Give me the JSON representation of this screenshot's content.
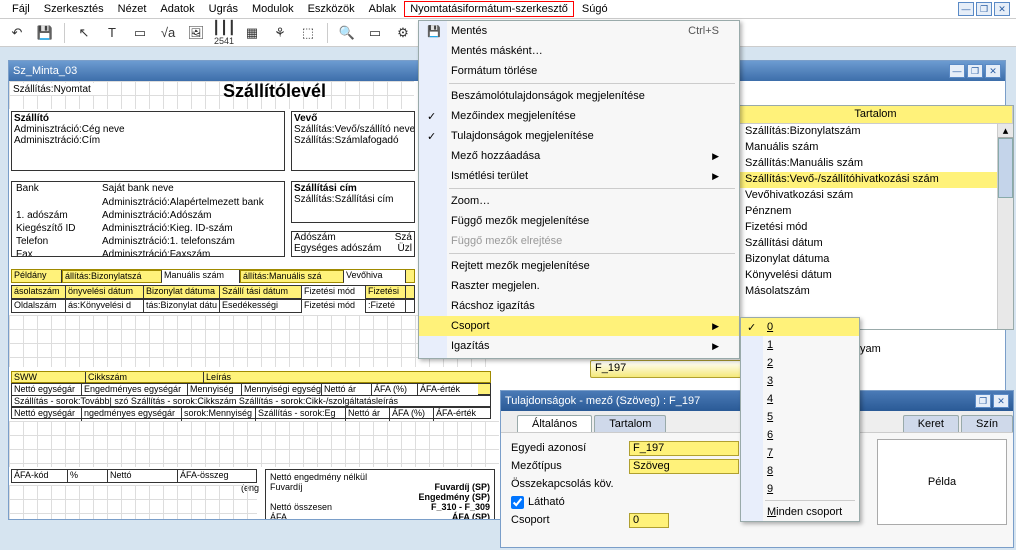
{
  "menubar": {
    "items": [
      "Fájl",
      "Szerkesztés",
      "Nézet",
      "Adatok",
      "Ugrás",
      "Modulok",
      "Eszközök",
      "Ablak",
      "Nyomtatásiformátum-szerkesztő",
      "Súgó"
    ]
  },
  "toolbar": {
    "save_icon": "💾",
    "cursor_icon": "↖",
    "text_icon": "T",
    "field_icon": "▭",
    "sigma_icon": "√a",
    "pic_icon": "🖼",
    "barcode1_icon": "┃┃┃",
    "barcode1_sub": "2541",
    "barcode2_icon": "▦",
    "sys_icon": "⚘",
    "ext_icon": "⬚",
    "zoom_icon": "🔍",
    "page_icon": "▭",
    "tool_icon": "⚙"
  },
  "docwin": {
    "title": "Sz_Minta_03"
  },
  "sheet": {
    "title": "Szállítólevél",
    "top_left": "Szállítás:Nyomtat",
    "shipper": {
      "header": "Szállító",
      "lines": [
        "Adminisztráció:Cég neve",
        "Adminisztráció:Cím"
      ]
    },
    "recipient": {
      "header": "Vevő",
      "lines": [
        "Szállítás:Vevő/szállító neve",
        "Szállítás:Számlafogadó"
      ]
    },
    "bank": {
      "label": "Bank",
      "value": "Saját bank neve",
      "rows": [
        {
          "l": "",
          "v": "Adminisztráció:Alapértelmezett bank"
        },
        {
          "l": "1. adószám",
          "v": "Adminisztráció:Adószám"
        },
        {
          "l": "Kiegészítő ID",
          "v": "Adminisztráció:Kieg. ID-szám"
        },
        {
          "l": "Telefon",
          "v": "Adminisztráció:1. telefonszám"
        },
        {
          "l": "Fax",
          "v": "Adminisztráció:Faxszám"
        }
      ]
    },
    "shipaddr": {
      "header": "Szállítási cím",
      "line": "Szállítás:Szállítási cím"
    },
    "misc": [
      {
        "l": "Adószám",
        "r": "Szá"
      },
      {
        "l": "Egységes adószám",
        "r": "Üzl"
      }
    ],
    "headrow": [
      "Példány",
      "állítás:Bizonylatszá",
      "Manuális szám",
      "állítás:Manuális szá",
      "Vevőhiva"
    ],
    "subrow1": [
      "ásolatszám",
      "önyvelési dátum",
      "Bizonylat dátuma",
      "Szállí tási dátum",
      "Fizetési mód",
      "Fizetési"
    ],
    "subrow2": [
      "Oldalszám",
      "ás:Könyvelési d",
      "tás:Bizonylat dátu",
      "Esedékességi",
      "Fizetési mód",
      ":Fizeté"
    ]
  },
  "lines": {
    "hdr": [
      "SWW",
      "Cikkszám",
      "Leírás"
    ],
    "cols": [
      "Nettó egységár",
      "Engedményes egységár",
      "Mennyiség",
      "Mennyiségi egység",
      "Nettó ár",
      "ÁFA (%)",
      "ÁFA-érték"
    ],
    "row1": "Szállítás - sorok:Tovább| szó   Szállítás - sorok:Cikkszám         Szállítás - sorok:Cikk-/szolgáltatásleírás",
    "row2": [
      "Nettó egységár",
      "ngedményes egységár",
      "sorok:Mennyiség",
      "Szállítás - sorok:Eg",
      "",
      "Nettó ár",
      "ÁFA (%)",
      "",
      "ÁFA-érték"
    ]
  },
  "afarows": {
    "hdr": [
      "ÁFA-kód",
      "%",
      "Nettó",
      "ÁFA-összeg"
    ],
    "eng": "(eng"
  },
  "totals": {
    "r1": {
      "l": "Nettó engedmény nélkül"
    },
    "r2": {
      "l": "Fuvardíj",
      "r": "Fuvardíj (SP)"
    },
    "r3": {
      "l": "",
      "r": "Engedmény (SP)"
    },
    "r4": {
      "l": "Nettó összesen",
      "r": "F_310 - F_309"
    },
    "r5": {
      "l": "ÁFA",
      "r": "ÁFA (SP)"
    }
  },
  "dropdown": {
    "save_icon": "💾",
    "items": [
      {
        "t": "Mentés",
        "s": "Ctrl+S",
        "icon": true
      },
      {
        "t": "Mentés másként…"
      },
      {
        "t": "Formátum törlése"
      },
      {
        "sep": true
      },
      {
        "t": "Beszámolótulajdonságok megjelenítése"
      },
      {
        "t": "Mezőindex megjelenítése",
        "chk": true
      },
      {
        "t": "Tulajdonságok megjelenítése",
        "chk": true
      },
      {
        "t": "Mező hozzáadása",
        "arrow": true
      },
      {
        "t": "Ismétlési terület",
        "arrow": true
      },
      {
        "sep": true
      },
      {
        "t": "Zoom…"
      },
      {
        "t": "Függő mezők megjelenítése"
      },
      {
        "t": "Függő mezők elrejtése",
        "dim": true
      },
      {
        "sep": true
      },
      {
        "t": "Rejtett mezők megjelenítése"
      },
      {
        "t": "Raszter megjelen."
      },
      {
        "t": "Rácshoz igazítás"
      },
      {
        "t": "Csoport",
        "arrow": true,
        "hl": true
      },
      {
        "t": "Igazítás",
        "arrow": true
      }
    ]
  },
  "submenu": {
    "items": [
      {
        "t": "0",
        "chk": true,
        "hl": true
      },
      {
        "t": "1"
      },
      {
        "t": "2"
      },
      {
        "t": "3"
      },
      {
        "t": "4"
      },
      {
        "t": "5"
      },
      {
        "t": "6"
      },
      {
        "t": "7"
      },
      {
        "t": "8"
      },
      {
        "t": "9"
      },
      {
        "sep": true
      },
      {
        "t": "Minden csoport"
      }
    ]
  },
  "behind_label": "yam",
  "fieldpanel": {
    "tab": "Tartalom",
    "rows": [
      "Szállítás:Bizonylatszám",
      "Manuális szám",
      "Szállítás:Manuális szám",
      "Szállítás:Vevő-/szállítóhivatkozási szám",
      "Vevőhivatkozási szám",
      "Pénznem",
      "Fizetési mód",
      "Szállítási dátum",
      "Bizonylat dátuma",
      "Könyvelési dátum",
      "Másolatszám"
    ]
  },
  "fval": "F_197",
  "props": {
    "title": "Tulajdonságok - mező (Szöveg) : F_197",
    "tabs": [
      "Általános",
      "Tartalom",
      "Keret",
      "Szín"
    ],
    "rows": [
      {
        "l": "Egyedi azonosí",
        "v": "F_197"
      },
      {
        "l": "Mezőtípus",
        "v": "Szöveg"
      },
      {
        "l": "Összekapcsolás köv.",
        "v": ""
      },
      {
        "l": "Látható",
        "cb": true
      },
      {
        "l": "Csoport",
        "v": "0"
      }
    ],
    "preview": "Példa"
  }
}
